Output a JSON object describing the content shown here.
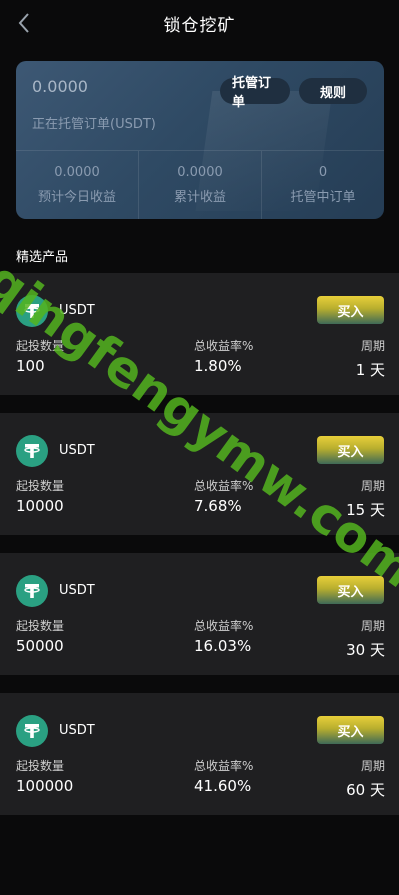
{
  "header": {
    "title": "锁仓挖矿",
    "back_icon": "chevron-left-icon"
  },
  "summary": {
    "total_value": "0.0000",
    "total_label": "正在托管订单(USDT)",
    "orders_button": "托管订单",
    "rules_button": "规则",
    "stats": [
      {
        "value": "0.0000",
        "label": "预计今日收益"
      },
      {
        "value": "0.0000",
        "label": "累计收益"
      },
      {
        "value": "0",
        "label": "托管中订单"
      }
    ]
  },
  "section_title": "精选产品",
  "labels": {
    "min_amount": "起投数量",
    "total_rate": "总收益率%",
    "period": "周期",
    "buy": "买入"
  },
  "products": [
    {
      "coin": "USDT",
      "min_amount": "100",
      "rate": "1.80%",
      "period": "1 天"
    },
    {
      "coin": "USDT",
      "min_amount": "10000",
      "rate": "7.68%",
      "period": "15 天"
    },
    {
      "coin": "USDT",
      "min_amount": "50000",
      "rate": "16.03%",
      "period": "30 天"
    },
    {
      "coin": "USDT",
      "min_amount": "100000",
      "rate": "41.60%",
      "period": "60 天"
    }
  ],
  "watermark": "qingfengymw.com",
  "colors": {
    "background": "#0a0a0b",
    "card": "#1f1f21",
    "summary_card": "#2f4a64",
    "coin": "#2aa082",
    "buy_button_top": "#e8cf3a",
    "watermark": "#54b41e"
  }
}
